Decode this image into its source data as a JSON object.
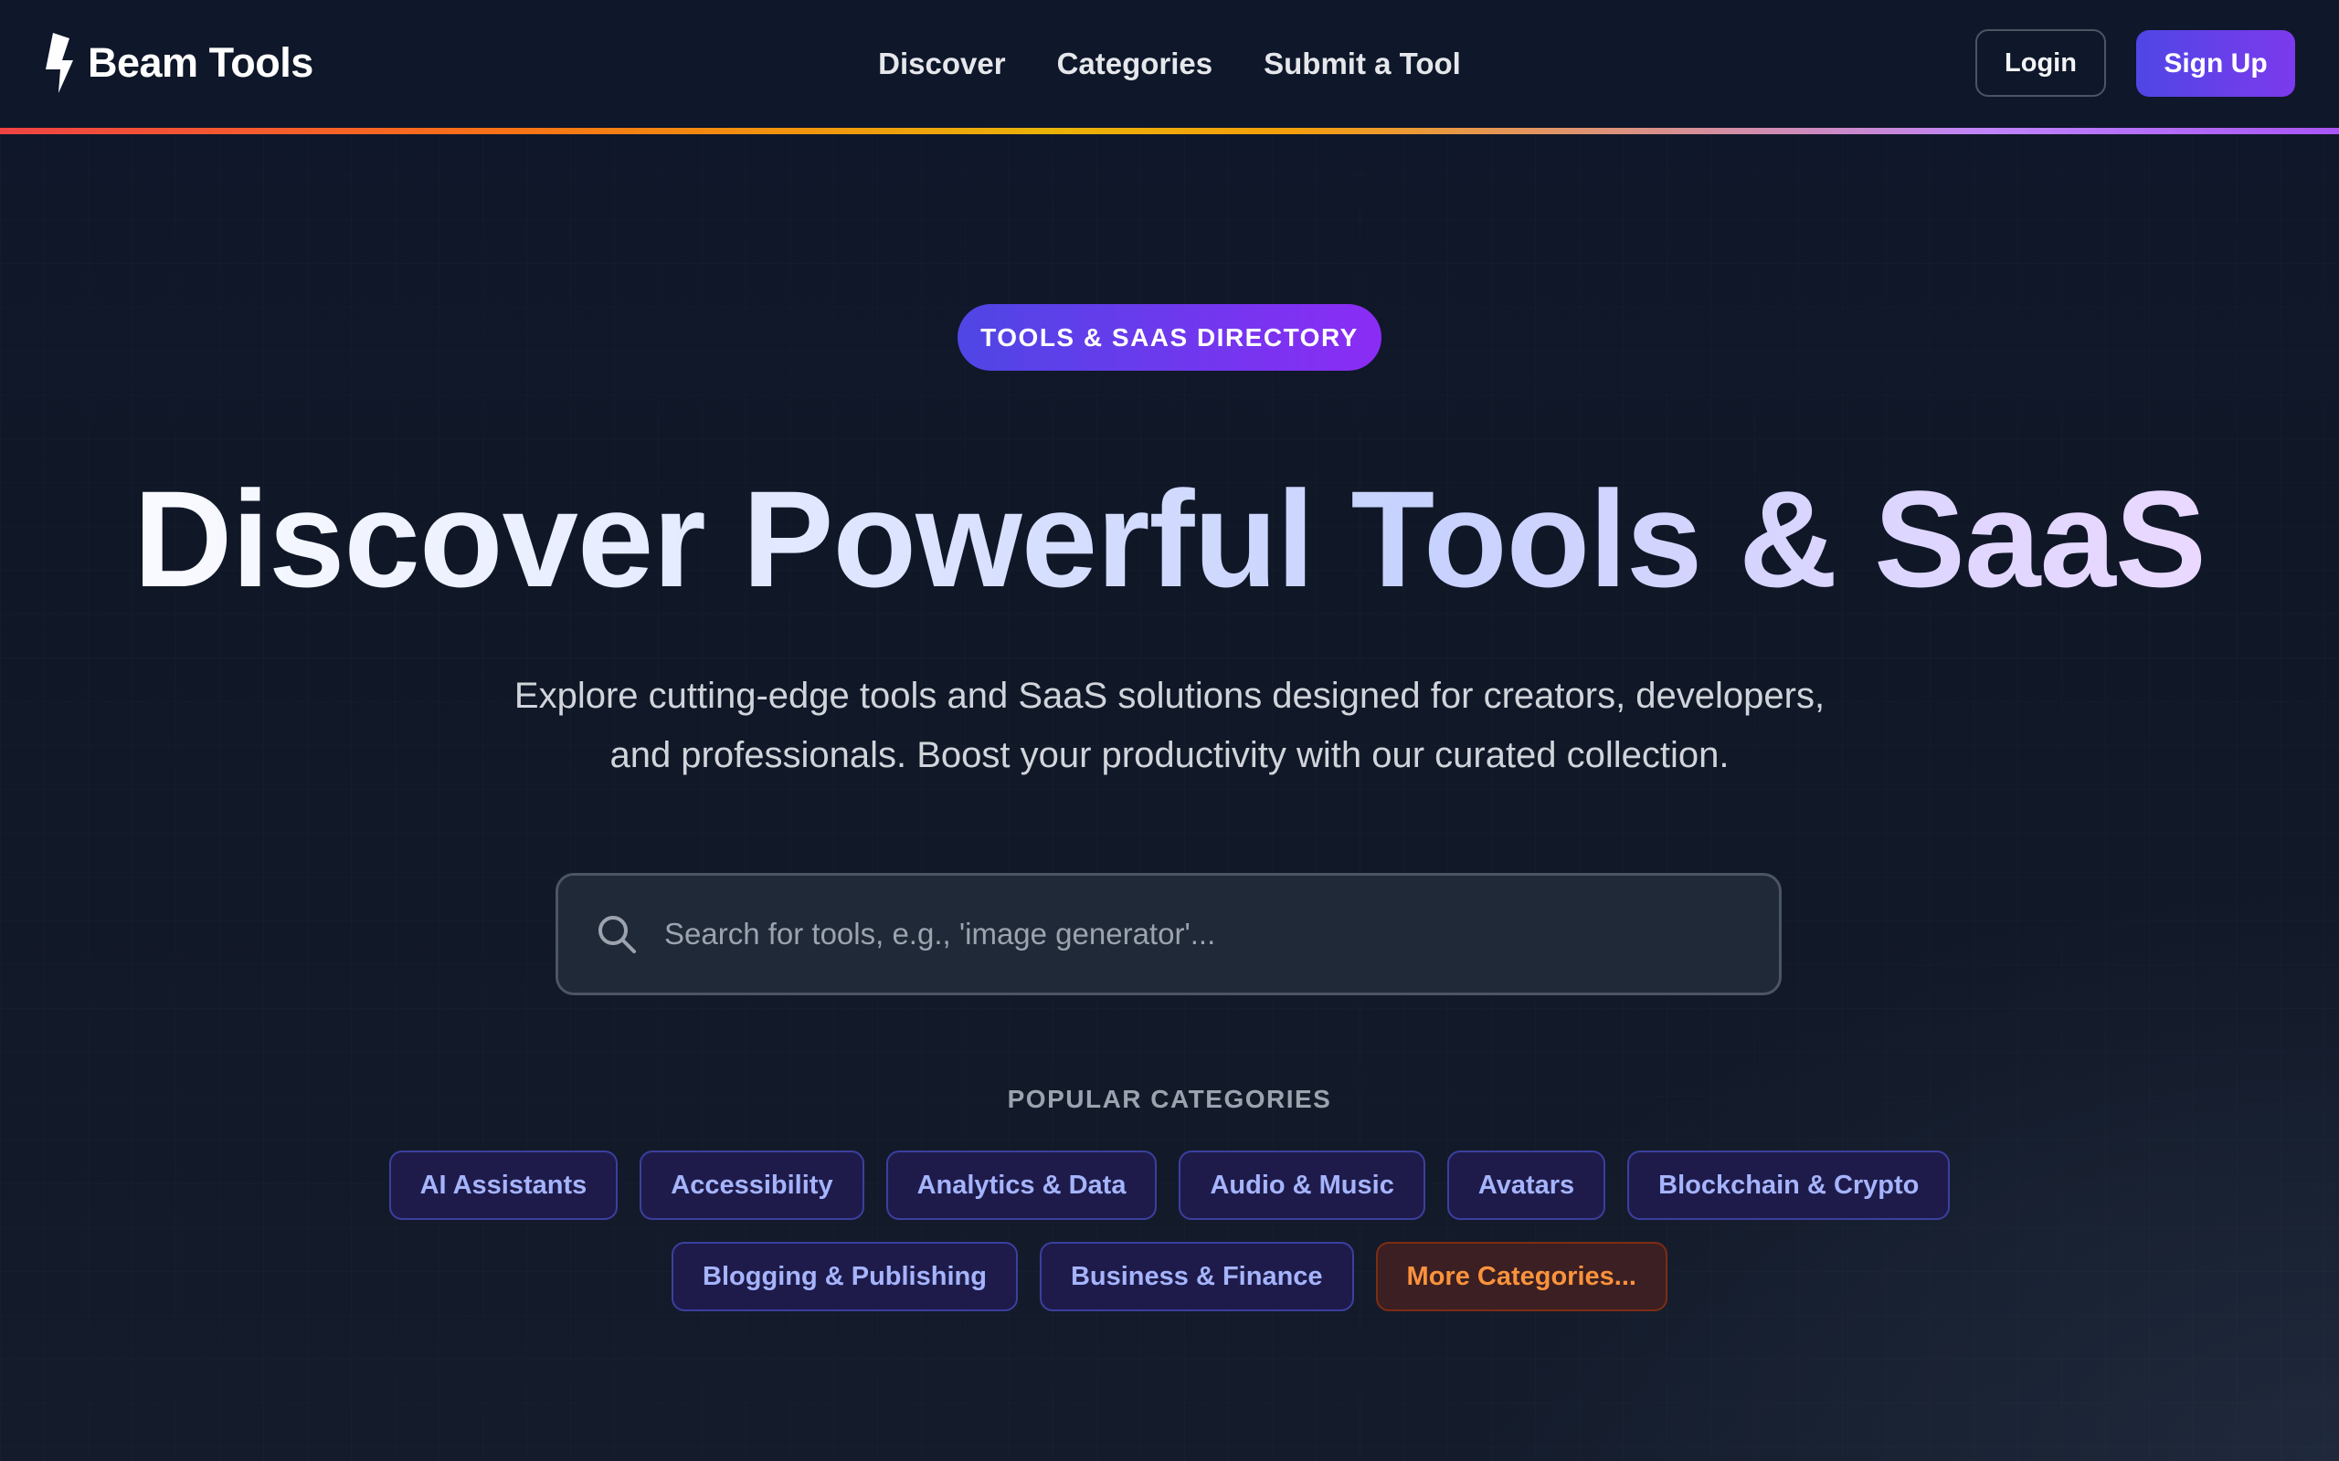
{
  "header": {
    "brand_name": "Beam Tools",
    "brand_icon": "lightning-bolt-icon",
    "nav": [
      {
        "label": "Discover"
      },
      {
        "label": "Categories"
      },
      {
        "label": "Submit a Tool"
      }
    ],
    "login_label": "Login",
    "signup_label": "Sign Up"
  },
  "hero": {
    "badge": "TOOLS & SAAS DIRECTORY",
    "headline": "Discover Powerful Tools & SaaS",
    "subtitle_line1": "Explore cutting-edge tools and SaaS solutions designed for creators, developers,",
    "subtitle_line2": "and professionals. Boost your productivity with our curated collection."
  },
  "search": {
    "placeholder": "Search for tools, e.g., 'image generator'...",
    "value": "",
    "icon": "search-icon"
  },
  "categories": {
    "title": "POPULAR CATEGORIES",
    "row1": [
      "AI Assistants",
      "Accessibility",
      "Analytics & Data",
      "Audio & Music",
      "Avatars",
      "Blockchain & Crypto"
    ],
    "row2": [
      "Blogging & Publishing",
      "Business & Finance"
    ],
    "more_label": "More Categories..."
  },
  "colors": {
    "background": "#111827",
    "accent": "#4f46e5",
    "accent_end": "#7c3aed",
    "chip_text": "#a5b4fc",
    "more_text": "#fb923c"
  }
}
